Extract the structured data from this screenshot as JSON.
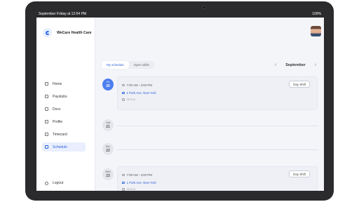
{
  "status_bar": {
    "datetime": "September Friday at 12:54 PM",
    "battery": "100%"
  },
  "sidebar": {
    "brand": "WeCare Health Care",
    "items": [
      {
        "label": "Home",
        "icon": "home-icon"
      },
      {
        "label": "Paystubs",
        "icon": "wallet-icon"
      },
      {
        "label": "Docs",
        "icon": "document-icon"
      },
      {
        "label": "Profile",
        "icon": "user-icon"
      },
      {
        "label": "Timecard",
        "icon": "clock-icon"
      },
      {
        "label": "Schedule",
        "icon": "calendar-icon",
        "active": true
      }
    ],
    "logout": "Logout"
  },
  "tabs": [
    {
      "label": "My schedule",
      "active": true
    },
    {
      "label": "Open shifts",
      "active": false
    }
  ],
  "month": "September",
  "days": [
    {
      "weekday": "Fri",
      "day": "20"
    },
    {
      "weekday": "Sat",
      "day": "21"
    },
    {
      "weekday": "Sun",
      "day": "22"
    },
    {
      "weekday": "Mon",
      "day": "23"
    }
  ],
  "shifts": [
    {
      "time": "7:00 AM - 3:00 PM",
      "location": "1 Park Ave, New York",
      "distance": "25.8 mi",
      "button": "Day Shift"
    },
    {
      "time": "7:00 AM - 3:00 PM",
      "location": "1 Park Ave, New York",
      "distance": "25.8 mi",
      "button": "Day Shift"
    }
  ],
  "colors": {
    "accent": "#2f62d8",
    "today_badge": "#4d7ef0",
    "active_nav_bg": "#e9effe"
  }
}
